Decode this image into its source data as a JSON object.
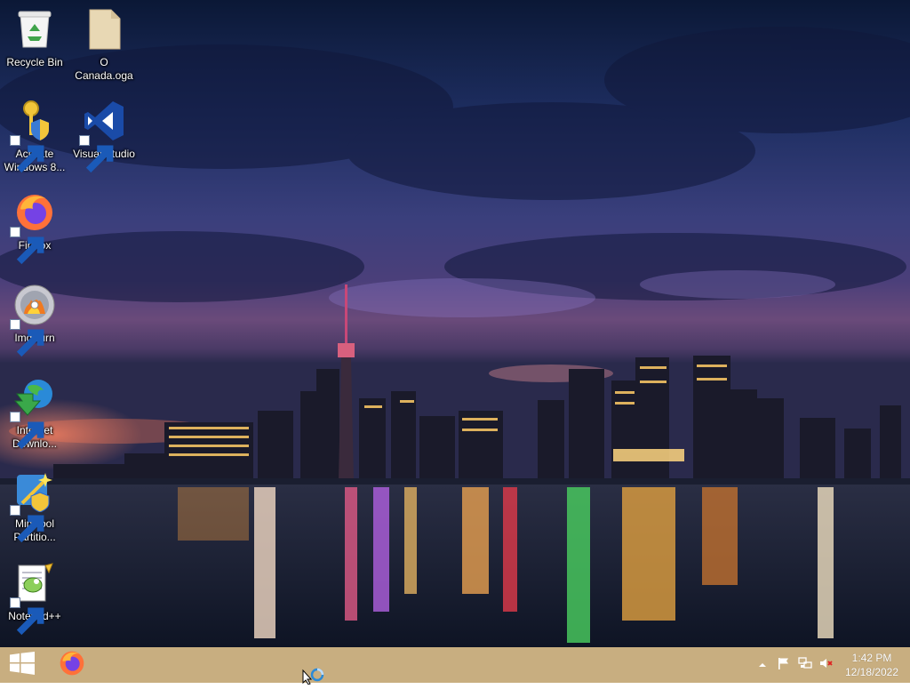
{
  "desktop": {
    "icons": [
      {
        "id": "recycle-bin",
        "label": "Recycle Bin"
      },
      {
        "id": "o-canada",
        "label": "O Canada.oga"
      },
      {
        "id": "activate-windows",
        "label": "Activate Windows 8..."
      },
      {
        "id": "visual-studio",
        "label": "Visual Studio"
      },
      {
        "id": "firefox",
        "label": "Firefox"
      },
      {
        "id": "imgburn",
        "label": "ImgBurn"
      },
      {
        "id": "internet-download",
        "label": "Internet Downlo..."
      },
      {
        "id": "minitool",
        "label": "MiniTool Partitio..."
      },
      {
        "id": "notepadpp",
        "label": "Notepad++"
      }
    ]
  },
  "taskbar": {
    "pinned": [
      "windows-logo-icon",
      "firefox-icon"
    ],
    "tray_icons": [
      "chevron-up-icon",
      "flag-icon",
      "network-icon",
      "speaker-muted-icon"
    ],
    "clock": {
      "time": "1:42 PM",
      "date": "12/18/2022"
    }
  },
  "colors": {
    "taskbar": "#c4a876",
    "accent_firefox": "#ff7139"
  }
}
